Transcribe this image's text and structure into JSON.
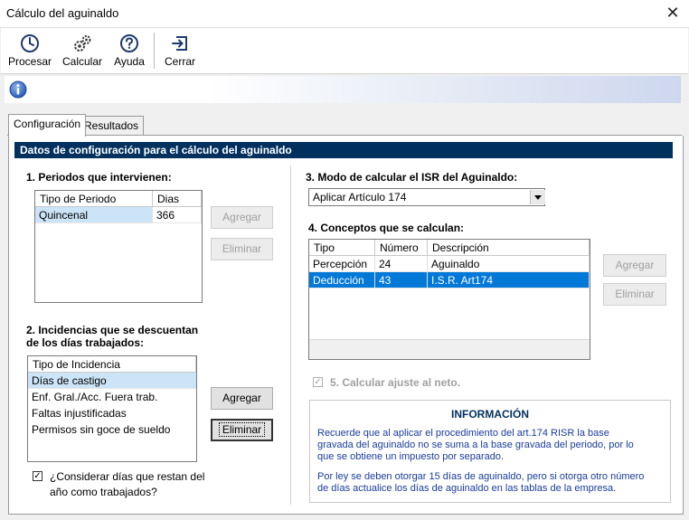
{
  "window": {
    "title": "Cálculo del aguinaldo",
    "close_glyph": "✕"
  },
  "toolbar": {
    "buttons": [
      {
        "label": "Procesar",
        "icon": "clock-icon"
      },
      {
        "label": "Calcular",
        "icon": "gears-icon"
      },
      {
        "label": "Ayuda",
        "icon": "help-icon"
      },
      {
        "label": "Cerrar",
        "icon": "exit-icon"
      }
    ]
  },
  "infobar": {
    "icon": "info-icon"
  },
  "tabs": [
    {
      "label": "Configuración",
      "active": true
    },
    {
      "label": "Resultados",
      "active": false
    }
  ],
  "config": {
    "header": "Datos de configuración para el cálculo del aguinaldo",
    "periodos": {
      "label": "1. Periodos que intervienen:",
      "columns": [
        "Tipo de Periodo",
        "Dias"
      ],
      "rows": [
        {
          "tipo": "Quincenal",
          "dias": "366"
        }
      ],
      "agregar": "Agregar",
      "eliminar": "Eliminar"
    },
    "incidencias": {
      "label_line1": "2. Incidencias que se descuentan",
      "label_line2": "de los días trabajados:",
      "column": "Tipo de Incidencia",
      "rows": [
        "Días de castigo",
        "Enf. Gral./Acc. Fuera trab.",
        "Faltas injustificadas",
        "Permisos sin goce de sueldo"
      ],
      "agregar": "Agregar",
      "eliminar": "Eliminar"
    },
    "considerar": {
      "checked": true,
      "line1": "¿Considerar días que restan del",
      "line2": "año como trabajados?",
      "mark": "✓"
    },
    "modo_isr": {
      "label": "3. Modo de calcular el ISR del Aguinaldo:",
      "selected": "Aplicar Artículo 174"
    },
    "conceptos": {
      "label": "4. Conceptos que se calculan:",
      "columns": [
        "Tipo",
        "Número",
        "Descripción"
      ],
      "rows": [
        {
          "tipo": "Percepción",
          "numero": "24",
          "descripcion": "Aguinaldo"
        },
        {
          "tipo": "Deducción",
          "numero": "43",
          "descripcion": "I.S.R. Art174"
        }
      ],
      "agregar": "Agregar",
      "eliminar": "Eliminar"
    },
    "ajuste": {
      "checked": true,
      "label": "5. Calcular ajuste al neto.",
      "mark": "✓"
    },
    "informacion": {
      "title": "INFORMACIÓN",
      "p1_line1": "Recuerde que al aplicar el procedimiento del art.174 RISR la base",
      "p1_line2": "gravada del aguinaldo no se suma a la base gravada del periodo, por lo",
      "p1_line3": "que se obtiene un impuesto por separado.",
      "p2_line1": "Por ley se deben otorgar 15 días de aguinaldo, pero si otorga otro número",
      "p2_line2": "de días actualice los días de aguinaldo en las tablas de la empresa."
    }
  }
}
